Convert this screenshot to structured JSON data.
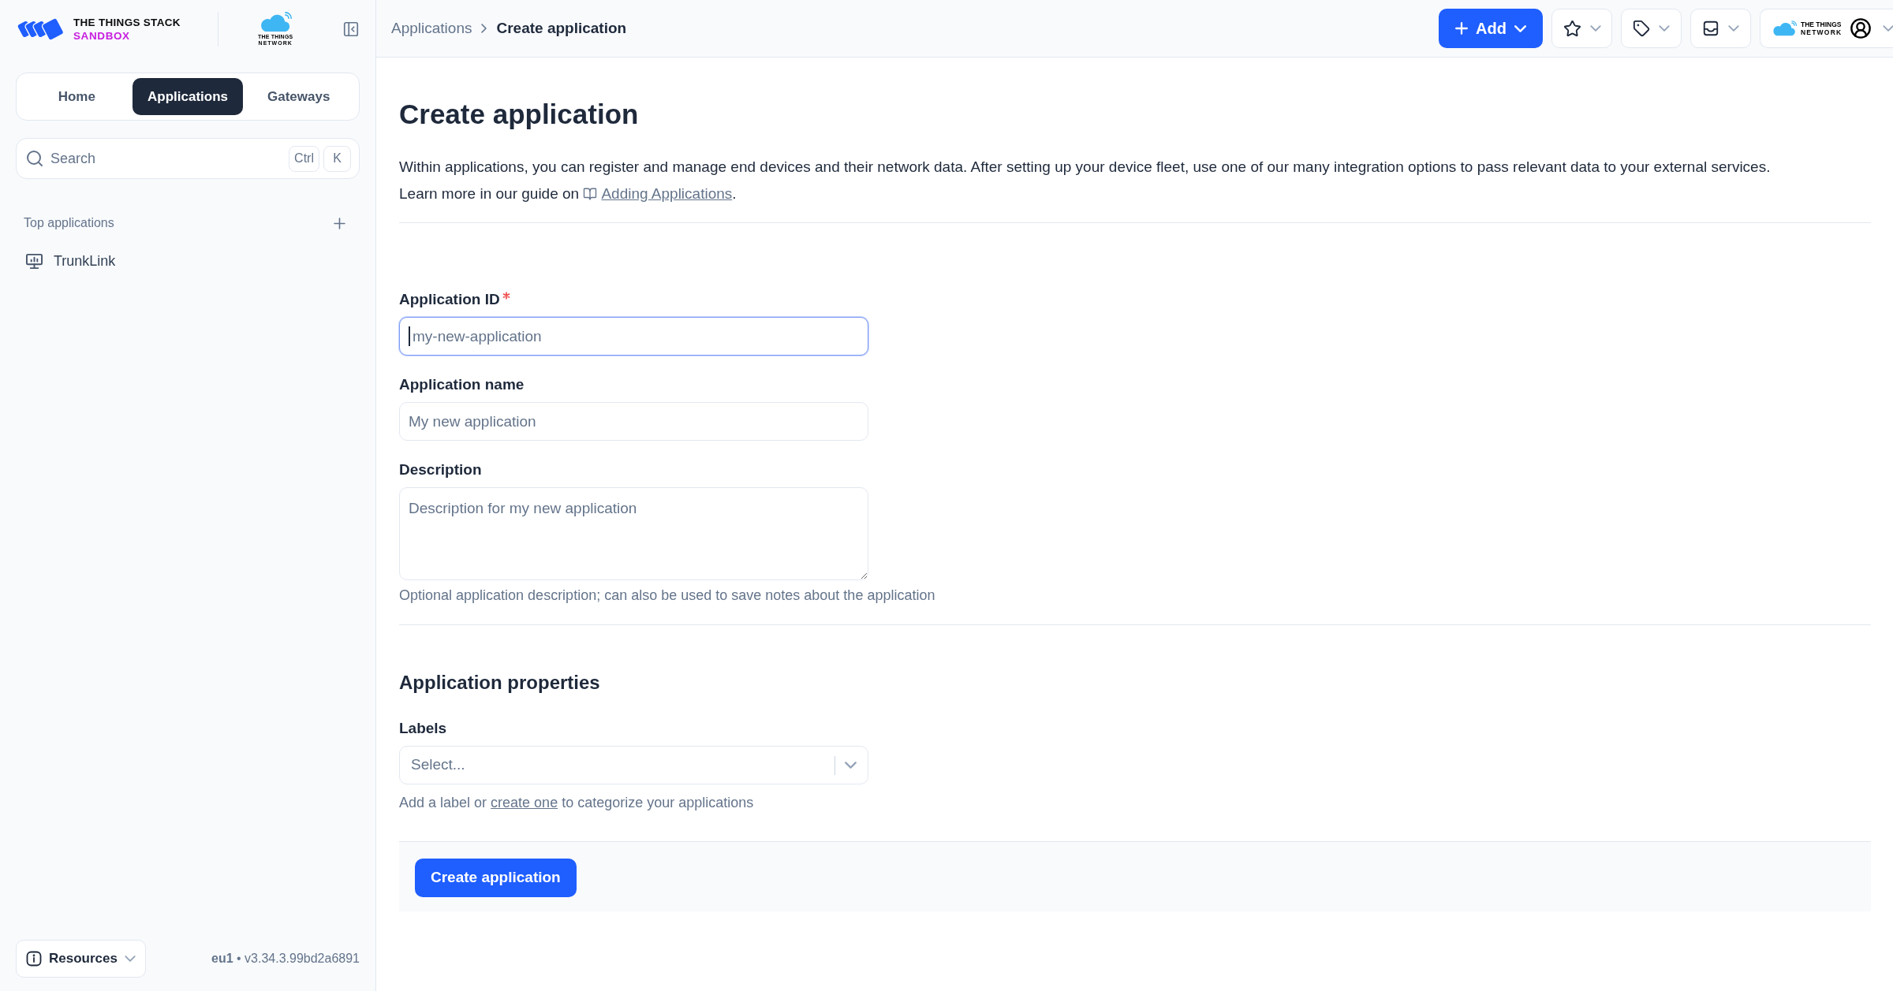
{
  "sidebar": {
    "logo": {
      "title": "THE THINGS STACK",
      "subtitle": "SANDBOX"
    },
    "partner_logo": {
      "line1": "THE THINGS",
      "line2": "NETWORK"
    },
    "tabs": [
      {
        "label": "Home",
        "selected": false
      },
      {
        "label": "Applications",
        "selected": true
      },
      {
        "label": "Gateways",
        "selected": false
      }
    ],
    "search": {
      "placeholder": "Search",
      "keys": [
        "Ctrl",
        "K"
      ]
    },
    "top_applications": {
      "title": "Top applications",
      "items": [
        {
          "label": "TrunkLink"
        }
      ]
    },
    "footer": {
      "resources_button": "Resources",
      "version": "**eu1** • v3.34.3.99bd2a6891"
    }
  },
  "header": {
    "breadcrumb": [
      {
        "label": "Applications",
        "current": false
      },
      {
        "label": "Create application",
        "current": true
      }
    ],
    "add_button": "Add",
    "menus": [
      {
        "kind": "star"
      },
      {
        "kind": "tag"
      },
      {
        "kind": "inbox"
      }
    ],
    "account": {
      "logo": {
        "line1": "THE THINGS",
        "line2": "NETWORK"
      }
    }
  },
  "page": {
    "title": "Create application",
    "intro": "Within applications, you can register and manage end devices and their network data. After setting up your device fleet, use one of our many integration options to pass relevant data to your external services.",
    "guide": {
      "text": "Learn more in our guide on ",
      "link": "Adding Applications",
      "end": "."
    },
    "fields": [
      {
        "kind": "input",
        "label": "Application ID",
        "required": true,
        "focused": true,
        "placeholder": "my-new-application"
      },
      {
        "kind": "input",
        "label": "Application name",
        "required": false,
        "focused": false,
        "placeholder": "My new application"
      },
      {
        "kind": "textarea",
        "label": "Description",
        "required": false,
        "focused": false,
        "placeholder": "Description for my new application",
        "help": "Optional application description; can also be used to save notes about the application"
      }
    ],
    "properties": {
      "title": "Application properties",
      "fields": [
        {
          "kind": "select",
          "label": "Labels",
          "required": false,
          "focused": false,
          "placeholder": "Select...",
          "help_parts": {
            "before": "Add a label or ",
            "link": "create one",
            "after": " to categorize your applications"
          }
        }
      ]
    },
    "submit_button": "Create application"
  }
}
